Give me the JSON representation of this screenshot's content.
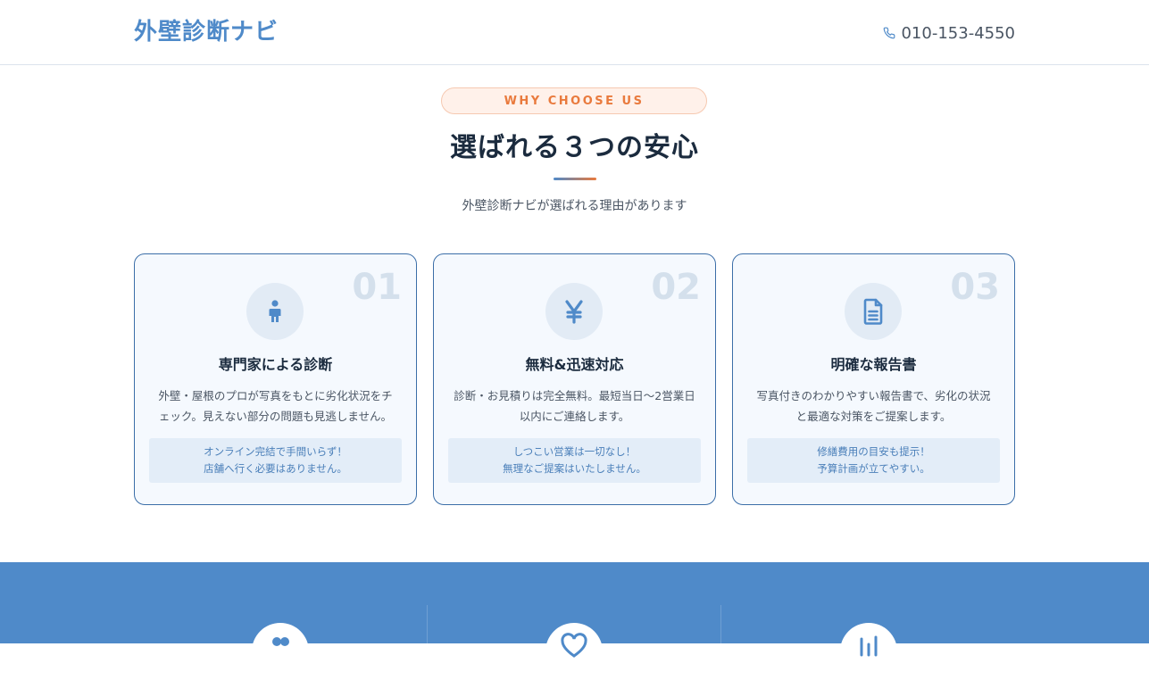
{
  "header": {
    "logo": "外壁診断ナビ",
    "phone": "010-153-4550",
    "phone_icon": "phone-icon"
  },
  "section": {
    "badge": "WHY CHOOSE US",
    "title": "選ばれる３つの安心",
    "subtitle": "外壁診断ナビが選ばれる理由があります"
  },
  "cards": [
    {
      "num": "01",
      "icon": "person-icon",
      "title": "専門家による診断",
      "desc_1": "外壁・屋根のプロが写真をもとに劣化状況をチ",
      "desc_2": "ェック。見えない部分の問題も見逃しません。",
      "note_1": "オンライン完結で手間いらず！",
      "note_2": "店舗へ行く必要はありません。"
    },
    {
      "num": "02",
      "icon": "yen-icon",
      "title": "無料&迅速対応",
      "desc_1": "診断・お見積りは完全無料。最短当日〜2営業日",
      "desc_2": "以内にご連絡します。",
      "note_1": "しつこい営業は一切なし！",
      "note_2": "無理なご提案はいたしません。"
    },
    {
      "num": "03",
      "icon": "document-icon",
      "title": "明確な報告書",
      "desc_1": "写真付きのわかりやすい報告書で、劣化の状況",
      "desc_2": "と最適な対策をご提案します。",
      "note_1": "修繕費用の目安も提示！",
      "note_2": "予算計画が立てやすい。"
    }
  ],
  "colors": {
    "brand_blue": "#4f8ac9",
    "accent_orange": "#e97a3d",
    "card_border": "#3b6ea8"
  }
}
